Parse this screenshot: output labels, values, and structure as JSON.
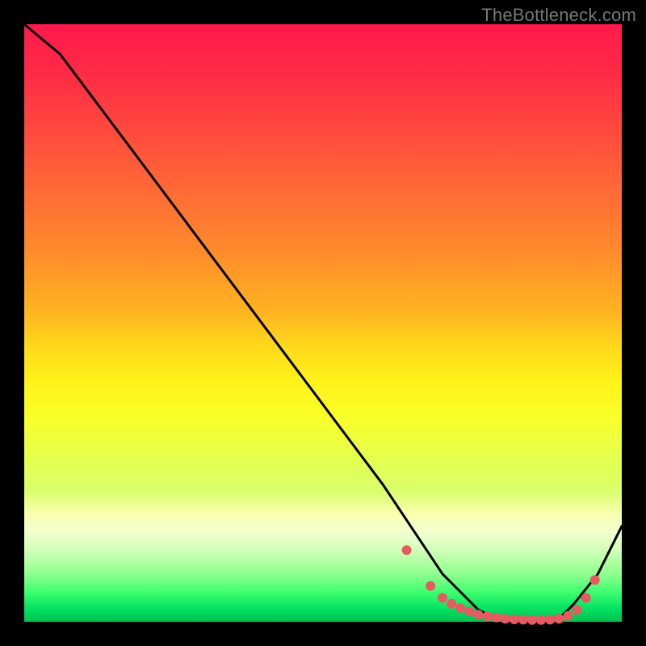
{
  "watermark": "TheBottleneck.com",
  "chart_data": {
    "type": "line",
    "title": "",
    "xlabel": "",
    "ylabel": "",
    "xlim": [
      0,
      100
    ],
    "ylim": [
      0,
      100
    ],
    "series": [
      {
        "name": "curve",
        "x": [
          0,
          6,
          12,
          18,
          24,
          30,
          36,
          42,
          48,
          54,
          60,
          64,
          68,
          70,
          72,
          74,
          76,
          78,
          80,
          82,
          84,
          86,
          88,
          90,
          92,
          96,
          100
        ],
        "y": [
          100,
          95,
          87,
          79,
          71,
          63,
          55,
          47,
          39,
          31,
          23,
          17,
          11,
          8,
          6,
          4,
          2,
          1,
          0.5,
          0.3,
          0.3,
          0.3,
          0.4,
          1,
          3,
          8,
          16
        ]
      }
    ],
    "markers": {
      "name": "dots",
      "color": "#e85a62",
      "x": [
        64,
        68,
        70,
        71.5,
        73,
        74.5,
        76,
        77.5,
        79,
        80.5,
        82,
        83.5,
        85,
        86.5,
        88,
        89.5,
        91,
        92.5,
        94,
        95.5
      ],
      "y": [
        12,
        6,
        4,
        3,
        2.3,
        1.7,
        1.2,
        0.9,
        0.7,
        0.5,
        0.4,
        0.35,
        0.3,
        0.3,
        0.35,
        0.5,
        1,
        2,
        4,
        7
      ]
    },
    "colors": {
      "curve": "#000000",
      "marker": "#e85a62",
      "gradient_top": "#ff1a4b",
      "gradient_bottom": "#00c050"
    }
  }
}
